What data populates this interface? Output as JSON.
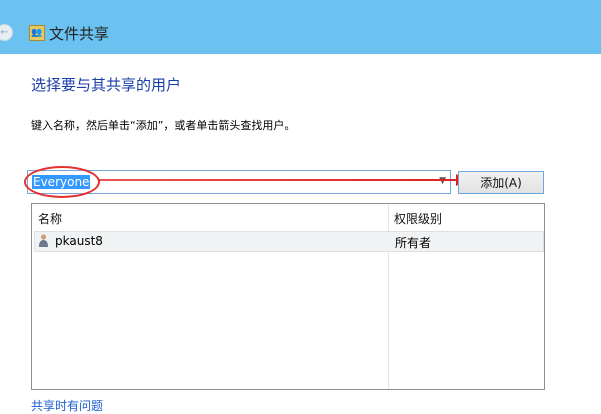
{
  "window": {
    "title": "文件共享",
    "back_icon": "back-arrow-icon",
    "app_icon": "users-share-icon"
  },
  "main": {
    "heading": "选择要与其共享的用户",
    "description": "键入名称，然后单击“添加”，或者单击箭头查找用户。",
    "user_combo": {
      "value": "Everyone"
    },
    "add_button": "添加(A)",
    "table": {
      "columns": [
        "名称",
        "权限级别"
      ],
      "rows": [
        {
          "name": "pkaust8",
          "permission": "所有者"
        }
      ]
    },
    "help_link": "共享时有问题"
  },
  "colors": {
    "titlebar": "#6bc1ef",
    "heading": "#1a3ea8",
    "annotation": "#e53030"
  }
}
